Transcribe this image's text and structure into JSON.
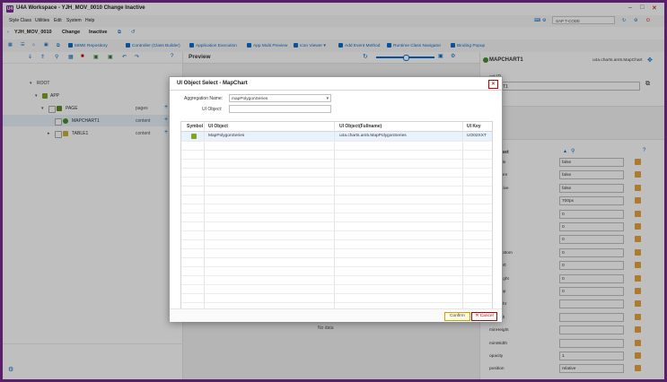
{
  "window": {
    "title": "U4A Workspace - YJH_MOV_0010 Change Inactive",
    "logo_text": "U4"
  },
  "menu": {
    "items": [
      "Style Class",
      "Utilities",
      "Edit",
      "System",
      "Help"
    ],
    "tcode_placeholder": "SAP T-CODE"
  },
  "ribbon": {
    "app_id": "YJH_MOV_0010",
    "mode": "Change",
    "status": "Inactive"
  },
  "toolbar": {
    "items": [
      "MIME Repository",
      "Controller (Class Builder)",
      "Application Execution",
      "App Multi Preview",
      "Icon Viewer",
      "Add Event Method",
      "Runtime Class Navigator",
      "Binding Popup"
    ]
  },
  "tree": {
    "rows": [
      {
        "label": "ROOT",
        "agg": ""
      },
      {
        "label": "APP",
        "agg": ""
      },
      {
        "label": "PAGE",
        "agg": "pages"
      },
      {
        "label": "MAPCHART1",
        "agg": "content"
      },
      {
        "label": "TABLE1",
        "agg": "content"
      }
    ]
  },
  "preview": {
    "title": "Preview",
    "no_data": "No data"
  },
  "properties": {
    "object_name": "MAPCHART1",
    "class_name": "u4a.charts.am5.MapChart",
    "object_id_label": "ect ID",
    "object_id_value": "CHART1",
    "dhen_label": "dhen",
    "reset_label": "Reset",
    "rows": [
      {
        "name": "oomable",
        "value": "false"
      },
      {
        "name": "ceHidden",
        "value": "false"
      },
      {
        "name": "ceInactive",
        "value": "false"
      },
      {
        "name": "ight",
        "value": "700px"
      },
      {
        "name": "le",
        "value": "0"
      },
      {
        "name": "rtert",
        "value": "0"
      },
      {
        "name": "rg",
        "value": "0"
      },
      {
        "name": "arginBottom",
        "value": "0"
      },
      {
        "name": "arginLeft",
        "value": "0"
      },
      {
        "name": "arginRight",
        "value": "0"
      },
      {
        "name": "arginTop",
        "value": "0"
      },
      {
        "name": "axHeight",
        "value": ""
      },
      {
        "name": "axWidth",
        "value": ""
      },
      {
        "name": "minHeight",
        "value": ""
      },
      {
        "name": "minWidth",
        "value": ""
      },
      {
        "name": "opacity",
        "value": "1"
      },
      {
        "name": "position",
        "value": "relative"
      }
    ]
  },
  "dialog": {
    "title": "UI Object Select - MapChart",
    "aggregation_label": "Aggregation Name:",
    "aggregation_value": "mapPolygonSeries",
    "ui_object_label": "UI Object:",
    "ui_object_value": "",
    "columns": [
      "Symbol",
      "UI Object",
      "UI Object(Fullname)",
      "UI Key"
    ],
    "row": {
      "object": "MapPolygonSeries",
      "fullname": "u4a.charts.am5.MapPolygonSeries",
      "key": "UO02XXT"
    },
    "confirm_label": "Confirm",
    "cancel_label": "Cancel"
  },
  "colors": {
    "frame": "#5a1f6b",
    "accent": "#0a6ed1"
  }
}
